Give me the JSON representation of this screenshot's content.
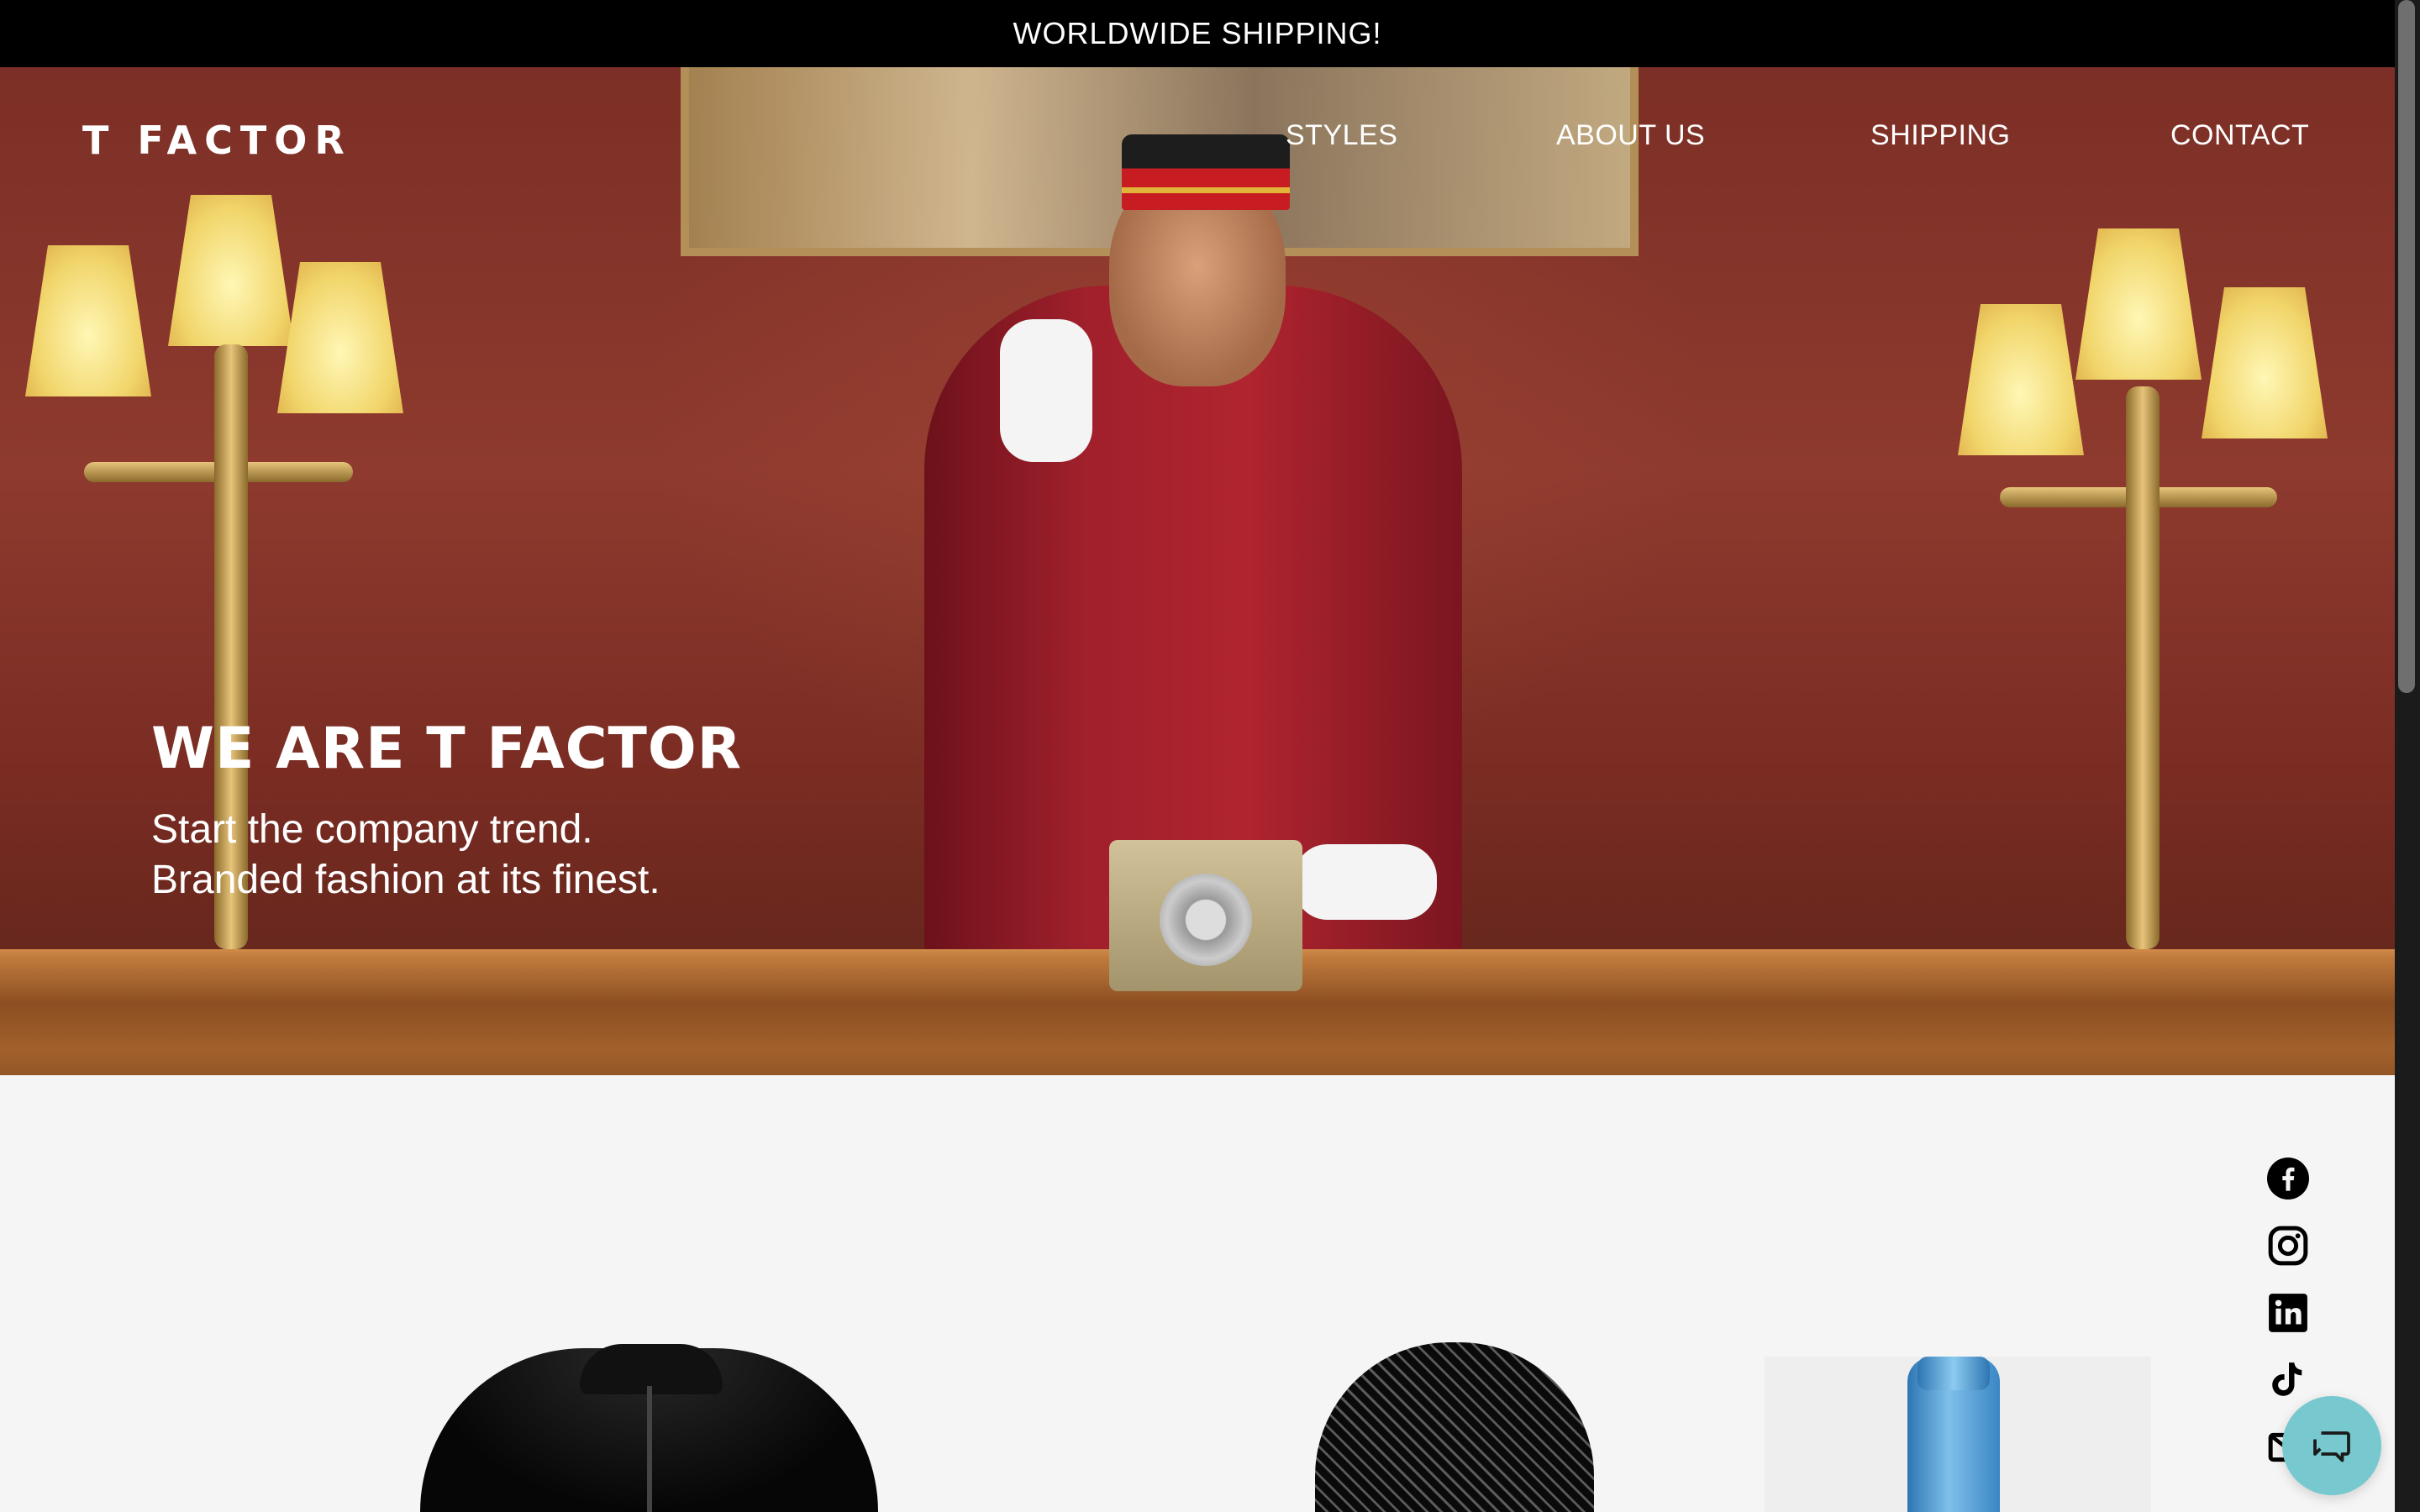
{
  "announcement": {
    "text": "WORLDWIDE SHIPPING!"
  },
  "header": {
    "logo_text": "T FACTOR",
    "nav": [
      {
        "label": "STYLES"
      },
      {
        "label": "ABOUT US"
      },
      {
        "label": "SHIPPING"
      },
      {
        "label": "CONTACT"
      }
    ]
  },
  "hero": {
    "title": "WE ARE T FACTOR",
    "subtitle_line1": "Start the company trend.",
    "subtitle_line2": "Branded fashion at its finest."
  },
  "social": [
    {
      "icon": "facebook-icon"
    },
    {
      "icon": "instagram-icon"
    },
    {
      "icon": "linkedin-icon"
    },
    {
      "icon": "tiktok-icon"
    },
    {
      "icon": "email-icon"
    }
  ],
  "products": [
    {
      "kind": "black fleece jacket"
    },
    {
      "kind": "black mesh cap"
    },
    {
      "kind": "blue water bottle"
    }
  ],
  "chat": {
    "icon": "chat-icon"
  },
  "colors": {
    "announcement_bg": "#000000",
    "page_bg": "#f5f5f5",
    "chat_bg": "#77c9cf"
  }
}
